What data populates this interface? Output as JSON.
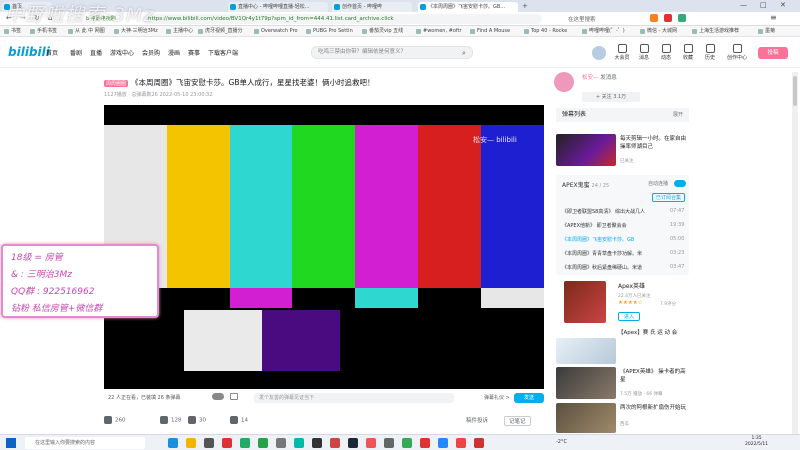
{
  "browser": {
    "tabs": [
      {
        "label": "首页"
      },
      {
        "label": "直播中心 - 哔哩哔哩直播-轻松..."
      },
      {
        "label": "创作首页 - 哔哩哔"
      },
      {
        "label": "《本周周圈》飞宙安慰卡莎。GB..."
      }
    ],
    "url": "https://www.bilibili.com/video/BV1Qr4y1t79p?spm_id_from=444.41.list.card_archive.click",
    "security_chip": "b 电影电视剧",
    "search_placeholder": "在这里搜索",
    "bookmarks": [
      "书签",
      "手机书签",
      "从 此 中 网图",
      "大神·三明治3Mz",
      "主播中心",
      "虎牙视频_直播分",
      "Overwatch Pro",
      "PUBG Pro Settin",
      "番茄灵vip 五线",
      "#women, #oftr",
      "Find A Mouse",
      "Top 40 - Rocke",
      "哔哩哔哩(゜-゜)",
      "微信 - 大城网",
      "上海生活游戏推荐",
      "墨菊"
    ]
  },
  "site": {
    "logo": "bilibili",
    "nav": [
      "首页",
      "番剧",
      "直播",
      "游戏中心",
      "会员购",
      "漫画",
      "赛事",
      "下载客户端"
    ],
    "search_placeholder": "吃鸡三禁由你带？编辑依是何意义？",
    "right_icons": [
      "大会员",
      "消息",
      "动态",
      "收藏",
      "历史",
      "创作中心"
    ],
    "upload": "投稿"
  },
  "video": {
    "tag": "周周圈圈",
    "title": "《本周周圈》飞宙安慰卡莎。GB单人成行，星星找老婆！俩小时追救吧！",
    "meta": "1127播放 · 总弹幕数26   2022-05-10 23:00:32",
    "watermark": "松安— bilibili",
    "danmaku_count": "22 人正在看，已装填 26 条弹幕",
    "danmaku_placeholder": "发个友善的弹幕见证当下",
    "danmaku_etiquette": "弹幕礼仪 >",
    "send": "发送",
    "actions": [
      {
        "icon": "like-icon",
        "label": "260"
      },
      {
        "icon": "coin-icon",
        "label": "128"
      },
      {
        "icon": "star-icon",
        "label": "30"
      },
      {
        "icon": "share-icon",
        "label": "14"
      }
    ],
    "report": "稿件投诉",
    "notes": "记笔记"
  },
  "overlay": {
    "stamp": "中野啦搜索-3Mz",
    "promo": [
      "18级  = 房管",
      " &  : 三明治3Mz",
      "QQ群  : 922516962",
      "钻粉 私信房管+微信群"
    ]
  },
  "sidebar": {
    "up_name": "松安—",
    "up_badge": "发消息",
    "follow": "+ 关注 3.1万",
    "danmaku_list": "弹幕列表",
    "danmaku_expand": "展开",
    "recos": [
      {
        "title": "每天剪辑一小时。在家自由操率师湖目己",
        "sub": "已关注"
      },
      {
        "title": "Apex英雄",
        "sub": "3.4万人已关注"
      }
    ],
    "collection": {
      "title": "APEX鬼蜜",
      "count": "24 / 25",
      "follow": "已订阅合集",
      "autoplay": "自动连播",
      "items": [
        {
          "title": "《即卫者联盟S8高清》 综出大战几人",
          "dur": "07:47"
        },
        {
          "title": "《APEX他新》 即卫者聚会会",
          "dur": "19:39"
        },
        {
          "title": "《本周周圈》飞宙安慰卡莎。GB",
          "dur": "05:00"
        },
        {
          "title": "《本周周圈》青青草盘卡莎功解。米",
          "dur": "03:23"
        },
        {
          "title": "《本周周圈》秋后紧盘稀硬山。米道",
          "dur": "03:47"
        }
      ]
    },
    "game": {
      "name": "Apex英雄",
      "followers": "22.4万人已关注",
      "rating": "7.9评分",
      "enter": "进入",
      "tagline": "【Apex】赛 氏 运 动 会"
    },
    "more": [
      {
        "title": "《APEX英雄》 操卡者的高星",
        "sub": "7.5万 播放 · 66 弹幕"
      },
      {
        "title": "两次的阿根新扩扇伤开始玩",
        "sub": "西瓜"
      }
    ]
  },
  "taskbar": {
    "search": "在这里输入你要搜索的内容",
    "weather": "-2°C",
    "time": "1:35",
    "date": "2022/5/11"
  }
}
